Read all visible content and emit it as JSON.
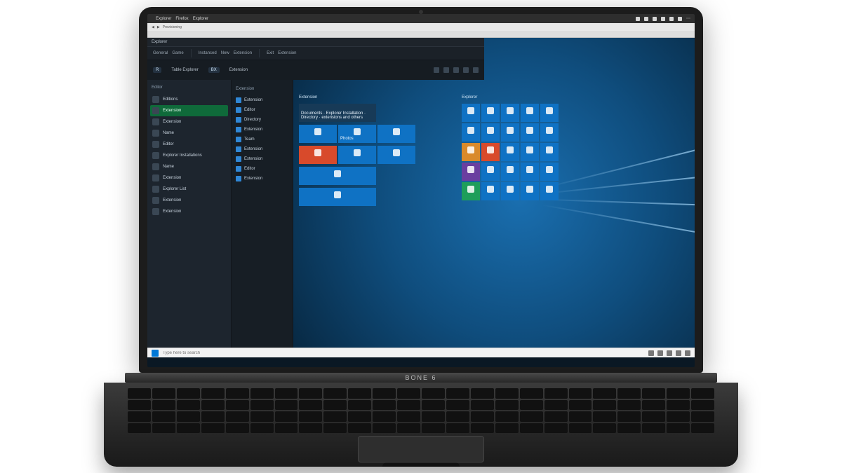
{
  "mac_menu": {
    "apple": "",
    "app": "Explorer",
    "items": [
      "Firefox",
      "Explorer"
    ]
  },
  "browser": {
    "url": "Provisioning"
  },
  "app": {
    "title_left": "Explorer",
    "toolbar": {
      "groups": [
        "General",
        "Game",
        "Instanced",
        "New",
        "Extension",
        "Exit",
        "Extension"
      ]
    },
    "ribbon": {
      "left_badge": "R",
      "left_text": "Table Explorer",
      "mid_badge": "BX",
      "mid_text": "Extension"
    },
    "sidebar": {
      "section": "Editor",
      "items": [
        {
          "label": "Editions",
          "icon": "globe",
          "active": false
        },
        {
          "label": "Extension",
          "icon": "leaf",
          "active": true
        },
        {
          "label": "Extension",
          "icon": "gear",
          "active": false
        },
        {
          "label": "Name",
          "icon": "tag",
          "active": false
        },
        {
          "label": "Editor",
          "icon": "pencil",
          "active": false
        },
        {
          "label": "Explorer Installations",
          "icon": "box",
          "active": false
        },
        {
          "label": "Name",
          "icon": "tag",
          "active": false
        },
        {
          "label": "Extension",
          "icon": "puzzle",
          "active": false
        },
        {
          "label": "Explorer List",
          "icon": "list",
          "active": false
        },
        {
          "label": "Extension",
          "icon": "puzzle",
          "active": false
        },
        {
          "label": "Extension",
          "icon": "puzzle",
          "active": false
        }
      ]
    },
    "sidebar2": {
      "header": "Extension",
      "items": [
        "Extension",
        "Editor",
        "Directory",
        "Extension",
        "Team",
        "Extension",
        "Extension",
        "Editor",
        "Extension"
      ]
    }
  },
  "start": {
    "group_a": {
      "label": "Extension",
      "hero": "Documents · Explorer Installation · Directory · extensions and others"
    },
    "group_b": {
      "label": "Explorer"
    },
    "tiles_labels": {
      "photos": "Photos",
      "mail": "",
      "store": "",
      "settings": "",
      "calc": "",
      "edge": "",
      "maps": "",
      "weather": ""
    }
  },
  "taskbar": {
    "search_placeholder": "Type here to search"
  },
  "laptop": {
    "brand": "BONE 6"
  }
}
